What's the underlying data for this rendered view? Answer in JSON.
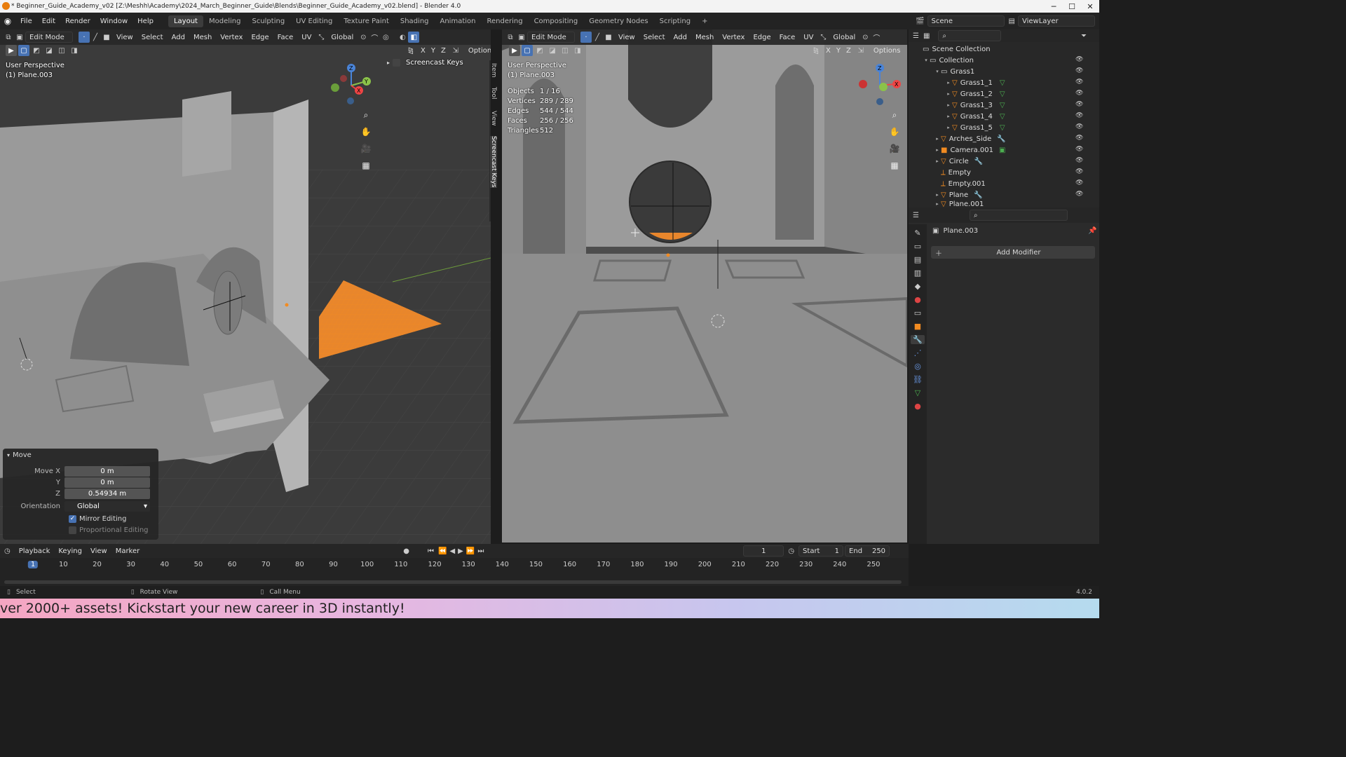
{
  "window": {
    "title": "* Beginner_Guide_Academy_v02 [Z:\\Meshh\\Academy\\2024_March_Beginner_Guide\\Blends\\Beginner_Guide_Academy_v02.blend] - Blender 4.0",
    "min": "─",
    "max": "☐",
    "close": "✕"
  },
  "menu": [
    "File",
    "Edit",
    "Render",
    "Window",
    "Help"
  ],
  "workspaces": [
    "Layout",
    "Modeling",
    "Sculpting",
    "UV Editing",
    "Texture Paint",
    "Shading",
    "Animation",
    "Rendering",
    "Compositing",
    "Geometry Nodes",
    "Scripting",
    "+"
  ],
  "scene": {
    "name": "Scene",
    "view_layer": "ViewLayer"
  },
  "viewport_left": {
    "mode": "Edit Mode",
    "menus": [
      "View",
      "Select",
      "Add",
      "Mesh",
      "Vertex",
      "Edge",
      "Face",
      "UV"
    ],
    "orientation": "Global",
    "axes": [
      "X",
      "Y",
      "Z"
    ],
    "options": "Options",
    "perspective": "User Perspective",
    "object": "(1) Plane.003",
    "screencast": "Screencast Keys",
    "side_tabs": [
      "Item",
      "Tool",
      "View",
      "Screencast Keys"
    ]
  },
  "viewport_right": {
    "mode": "Edit Mode",
    "menus": [
      "View",
      "Select",
      "Add",
      "Mesh",
      "Vertex",
      "Edge",
      "Face",
      "UV"
    ],
    "orientation": "Global",
    "axes": [
      "X",
      "Y",
      "Z"
    ],
    "options": "Options",
    "perspective": "User Perspective",
    "object": "(1) Plane.003",
    "stats": [
      {
        "label": "Objects",
        "value": "1 / 16"
      },
      {
        "label": "Vertices",
        "value": "289 / 289"
      },
      {
        "label": "Edges",
        "value": "544 / 544"
      },
      {
        "label": "Faces",
        "value": "256 / 256"
      },
      {
        "label": "Triangles",
        "value": "512"
      }
    ]
  },
  "move_panel": {
    "title": "Move",
    "move_x_label": "Move X",
    "move_x": "0 m",
    "y_label": "Y",
    "y": "0 m",
    "z_label": "Z",
    "z": "0.54934 m",
    "orientation_label": "Orientation",
    "orientation": "Global",
    "mirror": "Mirror Editing",
    "proportional": "Proportional Editing"
  },
  "outliner": {
    "scene_collection": "Scene Collection",
    "rows": [
      "Collection",
      "Grass1",
      "Grass1_1",
      "Grass1_2",
      "Grass1_3",
      "Grass1_4",
      "Grass1_5",
      "Arches_Side",
      "Camera.001",
      "Circle",
      "Empty",
      "Empty.001",
      "Plane",
      "Plane.001"
    ]
  },
  "properties": {
    "object_name": "Plane.003",
    "add_modifier": "Add Modifier"
  },
  "timeline": {
    "menus": [
      "Playback",
      "Keying",
      "View",
      "Marker"
    ],
    "current_frame": "1",
    "start_label": "Start",
    "start": "1",
    "end_label": "End",
    "end": "250",
    "ticks": [
      "1",
      "10",
      "20",
      "30",
      "40",
      "50",
      "60",
      "70",
      "80",
      "90",
      "100",
      "110",
      "120",
      "130",
      "140",
      "150",
      "160",
      "170",
      "180",
      "190",
      "200",
      "210",
      "220",
      "230",
      "240",
      "250"
    ]
  },
  "status": {
    "select": "Select",
    "rotate": "Rotate View",
    "call_menu": "Call Menu",
    "version": "4.0.2"
  },
  "banner": "ver 2000+ assets! Kickstart your new career in 3D instantly!",
  "colors": {
    "accent": "#4772b3",
    "selection": "#f28b21",
    "mesh_orange": "#e8862c"
  }
}
